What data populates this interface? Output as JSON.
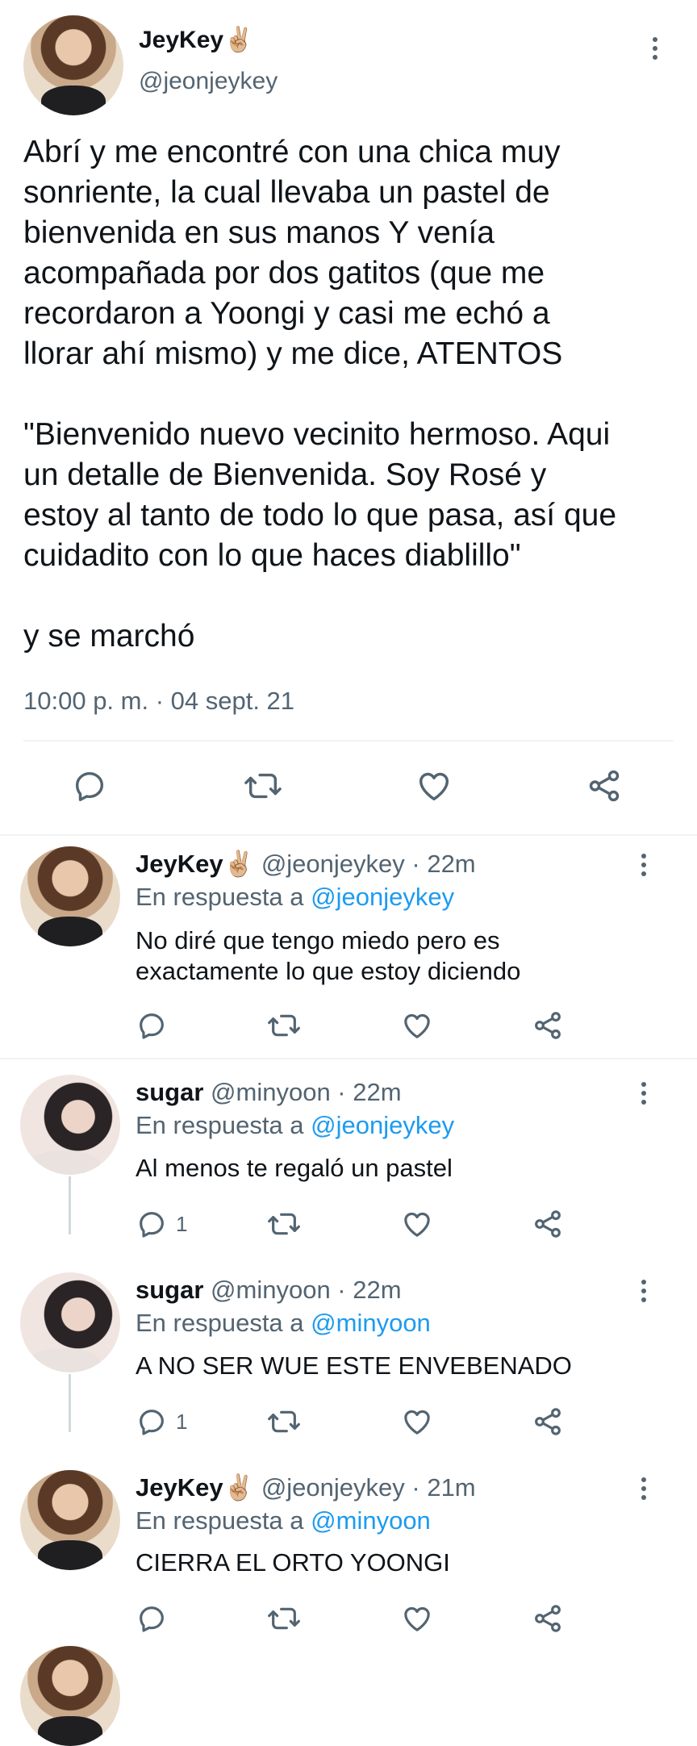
{
  "main_tweet": {
    "author_name": "JeyKey",
    "author_emoji": "✌🏼",
    "author_handle": "@jeonjeykey",
    "text": "Abrí y me encontré con una chica muy\nsonriente, la cual llevaba un pastel de\nbienvenida en sus manos Y venía\nacompañada por dos gatitos (que me\nrecordaron a Yoongi y casi me echó a\nllorar ahí mismo) y me dice, ATENTOS\n\n\"Bienvenido nuevo vecinito hermoso. Aqui\nun detalle de Bienvenida. Soy Rosé y\nestoy al tanto de todo lo que pasa, así que\ncuidadito con lo que haces diablillo\"\n\ny se marchó",
    "timestamp": "10:00 p. m. · 04 sept. 21",
    "icons": [
      "reply-icon",
      "retweet-icon",
      "like-icon",
      "share-icon"
    ]
  },
  "replies": [
    {
      "author_name": "JeyKey",
      "author_emoji": "✌🏼",
      "meta": "@jeonjeykey · 22m",
      "reply_prefix": "En respuesta a",
      "reply_to": "@jeonjeykey",
      "text": "No diré que tengo miedo pero es\nexactamente lo que estoy diciendo",
      "reply_count": ""
    },
    {
      "author_name": "sugar",
      "author_emoji": "",
      "meta": "@minyoon · 22m",
      "reply_prefix": "En respuesta a",
      "reply_to": "@jeonjeykey",
      "text": "Al menos te regaló un pastel",
      "reply_count": "1"
    },
    {
      "author_name": "sugar",
      "author_emoji": "",
      "meta": "@minyoon · 22m",
      "reply_prefix": "En respuesta a",
      "reply_to": "@minyoon",
      "text": "A NO SER WUE ESTE ENVEBENADO",
      "reply_count": "1"
    },
    {
      "author_name": "JeyKey",
      "author_emoji": "✌🏼",
      "meta": "@jeonjeykey · 21m",
      "reply_prefix": "En respuesta a",
      "reply_to": "@minyoon",
      "text": "CIERRA EL ORTO YOONGI",
      "reply_count": ""
    }
  ],
  "colors": {
    "text": "#0f1419",
    "muted": "#536471",
    "link": "#1d9bf0",
    "divider": "#eff3f4"
  }
}
